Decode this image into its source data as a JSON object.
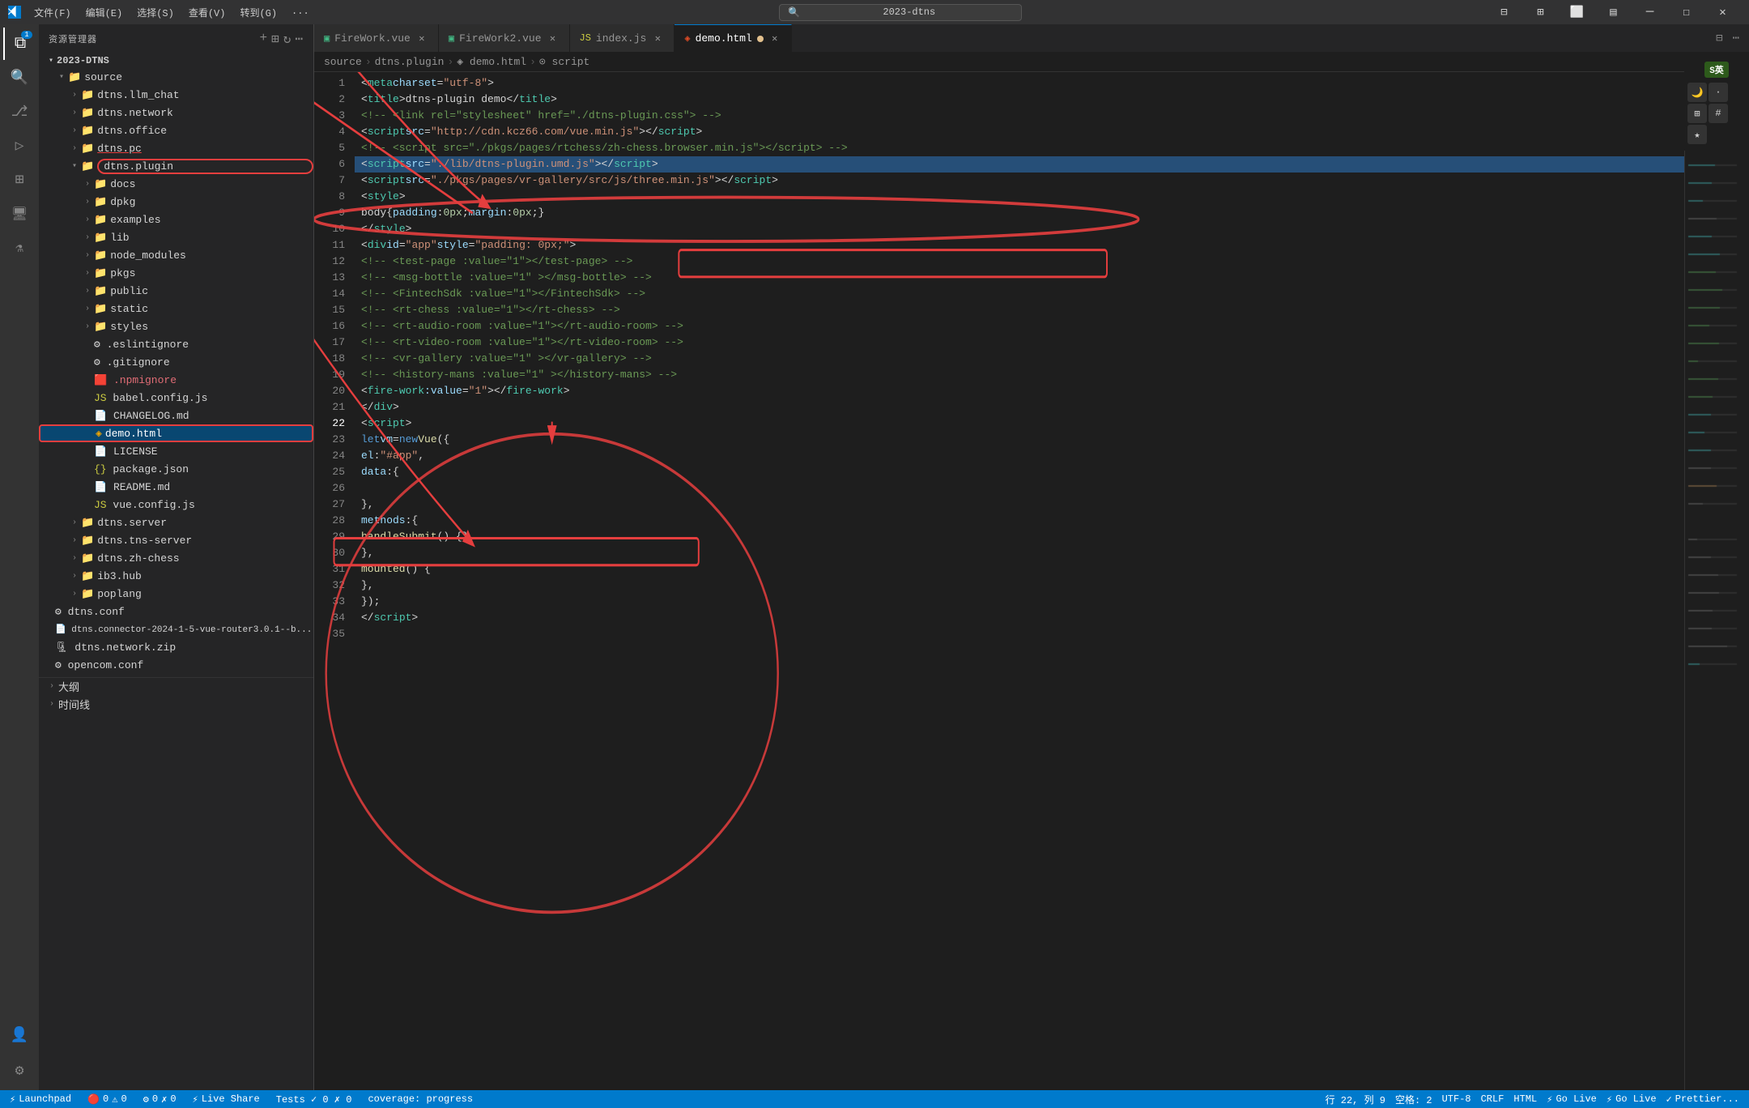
{
  "titleBar": {
    "icon": "VS",
    "menus": [
      "文件(F)",
      "编辑(E)",
      "选择(S)",
      "查看(V)",
      "转到(G)",
      "..."
    ],
    "searchPlaceholder": "2023-dtns",
    "controls": [
      "minimize",
      "maximize-restore",
      "close"
    ]
  },
  "activityBar": {
    "items": [
      {
        "name": "explorer",
        "icon": "⧉",
        "badge": "1",
        "active": true
      },
      {
        "name": "search",
        "icon": "🔍",
        "active": false
      },
      {
        "name": "source-control",
        "icon": "⎇",
        "active": false
      },
      {
        "name": "run-debug",
        "icon": "▷",
        "active": false
      },
      {
        "name": "extensions",
        "icon": "⊞",
        "active": false
      },
      {
        "name": "remote-explorer",
        "icon": "🖥",
        "active": false
      },
      {
        "name": "testing",
        "icon": "⚗",
        "active": false
      }
    ],
    "bottomItems": [
      {
        "name": "accounts",
        "icon": "👤"
      },
      {
        "name": "settings",
        "icon": "⚙"
      }
    ]
  },
  "sidebar": {
    "title": "资源管理器",
    "rootFolder": "2023-DTNS",
    "tree": [
      {
        "id": "source",
        "label": "source",
        "type": "folder",
        "indent": 0,
        "expanded": true
      },
      {
        "id": "dtns_llm_chat",
        "label": "dtns.llm_chat",
        "type": "folder",
        "indent": 1,
        "expanded": false
      },
      {
        "id": "dtns_network",
        "label": "dtns.network",
        "type": "folder",
        "indent": 1,
        "expanded": false
      },
      {
        "id": "dtns_office",
        "label": "dtns.office",
        "type": "folder",
        "indent": 1,
        "expanded": false
      },
      {
        "id": "dtns_pc",
        "label": "dtns.pc",
        "type": "folder",
        "indent": 1,
        "expanded": false,
        "highlighted": true
      },
      {
        "id": "dtns_plugin",
        "label": "dtns.plugin",
        "type": "folder",
        "indent": 1,
        "expanded": true,
        "circled": true
      },
      {
        "id": "docs",
        "label": "docs",
        "type": "folder",
        "indent": 2,
        "expanded": false
      },
      {
        "id": "dpkg",
        "label": "dpkg",
        "type": "folder",
        "indent": 2,
        "expanded": false
      },
      {
        "id": "examples",
        "label": "examples",
        "type": "folder",
        "indent": 2,
        "expanded": false
      },
      {
        "id": "lib",
        "label": "lib",
        "type": "folder",
        "indent": 2,
        "expanded": false
      },
      {
        "id": "node_modules",
        "label": "node_modules",
        "type": "folder",
        "indent": 2,
        "expanded": false
      },
      {
        "id": "pkgs",
        "label": "pkgs",
        "type": "folder",
        "indent": 2,
        "expanded": false
      },
      {
        "id": "public",
        "label": "public",
        "type": "folder",
        "indent": 2,
        "expanded": false
      },
      {
        "id": "static",
        "label": "static",
        "type": "folder",
        "indent": 2,
        "expanded": false
      },
      {
        "id": "styles",
        "label": "styles",
        "type": "folder",
        "indent": 2,
        "expanded": false
      },
      {
        "id": "eslintignore",
        "label": ".eslintignore",
        "type": "file",
        "indent": 2,
        "icon": "⚙"
      },
      {
        "id": "gitignore",
        "label": ".gitignore",
        "type": "file",
        "indent": 2,
        "icon": "⚙"
      },
      {
        "id": "npmignore",
        "label": ".npmignore",
        "type": "file",
        "indent": 2,
        "icon": "🟥"
      },
      {
        "id": "babel_config",
        "label": "babel.config.js",
        "type": "file",
        "indent": 2,
        "icon": "JS"
      },
      {
        "id": "changelog",
        "label": "CHANGELOG.md",
        "type": "file",
        "indent": 2,
        "icon": "📄"
      },
      {
        "id": "demo_html",
        "label": "demo.html",
        "type": "file",
        "indent": 2,
        "icon": "🔶",
        "active": true,
        "circled": true
      },
      {
        "id": "license",
        "label": "LICENSE",
        "type": "file",
        "indent": 2,
        "icon": "📄"
      },
      {
        "id": "package_json",
        "label": "package.json",
        "type": "file",
        "indent": 2,
        "icon": "{}"
      },
      {
        "id": "readme",
        "label": "README.md",
        "type": "file",
        "indent": 2,
        "icon": "📄"
      },
      {
        "id": "vue_config",
        "label": "vue.config.js",
        "type": "file",
        "indent": 2,
        "icon": "JS"
      },
      {
        "id": "dtns_server",
        "label": "dtns.server",
        "type": "folder",
        "indent": 1,
        "expanded": false
      },
      {
        "id": "dtns_tns_server",
        "label": "dtns.tns-server",
        "type": "folder",
        "indent": 1,
        "expanded": false
      },
      {
        "id": "dtns_zh_chess",
        "label": "dtns.zh-chess",
        "type": "folder",
        "indent": 1,
        "expanded": false
      },
      {
        "id": "ib3_hub",
        "label": "ib3.hub",
        "type": "folder",
        "indent": 1,
        "expanded": false
      },
      {
        "id": "poplang",
        "label": "poplang",
        "type": "folder",
        "indent": 1,
        "expanded": false
      },
      {
        "id": "dtns_conf",
        "label": "dtns.conf",
        "type": "file",
        "indent": 0,
        "icon": "⚙"
      },
      {
        "id": "dtns_connector",
        "label": "dtns.connector-2024-1-5-vue-router3.0.1--b...",
        "type": "file",
        "indent": 0,
        "icon": "📄"
      },
      {
        "id": "dtns_network_zip",
        "label": "dtns.network.zip",
        "type": "file",
        "indent": 0,
        "icon": "🗜"
      },
      {
        "id": "opencom_conf",
        "label": "opencom.conf",
        "type": "file",
        "indent": 0,
        "icon": "⚙"
      }
    ]
  },
  "tabs": [
    {
      "id": "firework_vue",
      "label": "FireWork.vue",
      "icon": "vue",
      "color": "#42b883",
      "modified": false,
      "active": false
    },
    {
      "id": "firework2_vue",
      "label": "FireWork2.vue",
      "icon": "vue",
      "color": "#42b883",
      "modified": false,
      "active": false
    },
    {
      "id": "index_js",
      "label": "index.js",
      "icon": "js",
      "color": "#cbcb41",
      "modified": false,
      "active": false
    },
    {
      "id": "demo_html",
      "label": "demo.html",
      "icon": "html",
      "color": "#e44d26",
      "modified": true,
      "active": true
    }
  ],
  "breadcrumb": {
    "items": [
      "source",
      "dtns.plugin",
      "demo.html",
      "script"
    ]
  },
  "codeLines": [
    {
      "num": 1,
      "html": "<span class='token-punct'>&lt;</span><span class='token-tag'>meta</span> <span class='token-attr'>charset</span><span class='token-punct'>=</span><span class='token-string'>\"utf-8\"</span><span class='token-punct'>&gt;</span>"
    },
    {
      "num": 2,
      "html": "<span class='token-punct'>&lt;</span><span class='token-tag'>title</span><span class='token-punct'>&gt;</span><span class='token-text'>dtns-plugin demo</span><span class='token-punct'>&lt;/</span><span class='token-tag'>title</span><span class='token-punct'>&gt;</span>"
    },
    {
      "num": 3,
      "html": "<span class='token-comment'>&lt;!-- &lt;link rel=\"stylesheet\" href=\"./dtns-plugin.css\"&gt; --&gt;</span>"
    },
    {
      "num": 4,
      "html": "<span class='token-punct'>&lt;</span><span class='token-tag'>script</span> <span class='token-attr'>src</span><span class='token-punct'>=</span><span class='token-string'>\"http://cdn.kcz66.com/vue.min.js\"</span><span class='token-punct'>&gt;&lt;/</span><span class='token-tag'>script</span><span class='token-punct'>&gt;</span>"
    },
    {
      "num": 5,
      "html": "<span class='token-comment'>&lt;!-- &lt;script src=\"./pkgs/pages/rtchess/zh-chess.browser.min.js\"&gt;&lt;/script&gt; --&gt;</span>"
    },
    {
      "num": 6,
      "html": "<span class='token-punct'>&lt;</span><span class='token-tag'>script</span> <span class='token-attr'>src</span><span class='token-punct'>=</span><span class='token-string'>\"./lib/dtns-plugin.umd.js\"</span><span class='token-punct'>&gt;&lt;/</span><span class='token-tag'>script</span><span class='token-punct'>&gt;</span>",
      "highlighted": true
    },
    {
      "num": 7,
      "html": "<span class='token-punct'>&lt;</span><span class='token-tag'>script</span> <span class='token-attr'>src</span><span class='token-punct'>=</span><span class='token-string'>\"./pkgs/pages/vr-gallery/src/js/three.min.js\"</span><span class='token-punct'>&gt;&lt;/</span><span class='token-tag'>script</span><span class='token-punct'>&gt;</span>"
    },
    {
      "num": 8,
      "html": "<span class='token-punct'>&lt;</span><span class='token-tag'>style</span><span class='token-punct'>&gt;</span>"
    },
    {
      "num": 9,
      "html": "  <span class='token-text'>body</span><span class='token-punct'>{</span><span class='token-property'>padding</span><span class='token-punct'>:</span> <span class='token-number'>0px</span><span class='token-punct'>;</span><span class='token-property'>margin</span><span class='token-punct'>:</span> <span class='token-number'>0px</span><span class='token-punct'>;}</span>"
    },
    {
      "num": 10,
      "html": "<span class='token-punct'>&lt;/</span><span class='token-tag'>style</span><span class='token-punct'>&gt;</span>"
    },
    {
      "num": 11,
      "html": "<span class='token-punct'>&lt;</span><span class='token-tag'>div</span> <span class='token-attr'>id</span><span class='token-punct'>=</span><span class='token-string'>\"app\"</span> <span class='token-attr'>style</span><span class='token-punct'>=</span><span class='token-string'>\"padding: 0px;\"</span><span class='token-punct'>&gt;</span>"
    },
    {
      "num": 12,
      "html": "  <span class='token-comment'>&lt;!-- &lt;test-page :value=\"1\"&gt;&lt;/test-page&gt; --&gt;</span>"
    },
    {
      "num": 13,
      "html": "  <span class='token-comment'>&lt;!-- &lt;msg-bottle :value=\"1\" &gt;&lt;/msg-bottle&gt; --&gt;</span>"
    },
    {
      "num": 14,
      "html": "  <span class='token-comment'>&lt;!-- &lt;FintechSdk :value=\"1\"&gt;&lt;/FintechSdk&gt; --&gt;</span>"
    },
    {
      "num": 15,
      "html": "  <span class='token-comment'>&lt;!-- &lt;rt-chess :value=\"1\"&gt;&lt;/rt-chess&gt; --&gt;</span>"
    },
    {
      "num": 16,
      "html": "  <span class='token-comment'>&lt;!-- &lt;rt-audio-room :value=\"1\"&gt;&lt;/rt-audio-room&gt; --&gt;</span>"
    },
    {
      "num": 17,
      "html": "  <span class='token-comment'>&lt;!-- &lt;rt-video-room :value=\"1\"&gt;&lt;/rt-video-room&gt; --&gt;</span>"
    },
    {
      "num": 18,
      "html": "  <span class='token-comment'>&lt;!-- &lt;vr-gallery :value=\"1\" &gt;&lt;/vr-gallery&gt; --&gt;</span>"
    },
    {
      "num": 19,
      "html": "  <span class='token-comment'>&lt;!-- &lt;history-mans :value=\"1\" &gt;&lt;/history-mans&gt; --&gt;</span>"
    },
    {
      "num": 20,
      "html": "  <span class='token-punct'>&lt;</span><span class='token-tag'>fire-work</span> <span class='token-attr'>:value</span><span class='token-punct'>=</span><span class='token-string'>\"1\"</span> <span class='token-punct'>&gt;&lt;/</span><span class='token-tag'>fire-work</span><span class='token-punct'>&gt;</span>"
    },
    {
      "num": 21,
      "html": "<span class='token-punct'>&lt;/</span><span class='token-tag'>div</span><span class='token-punct'>&gt;</span>"
    },
    {
      "num": 22,
      "html": "<span class='token-punct'>&lt;</span><span class='token-tag'>script</span><span class='token-punct'>&gt;</span>"
    },
    {
      "num": 23,
      "html": "<span class='token-keyword'>let</span> <span class='token-var'>vm</span> <span class='token-punct'>=</span> <span class='token-keyword'>new</span> <span class='token-func'>Vue</span><span class='token-punct'>({</span>"
    },
    {
      "num": 24,
      "html": "    <span class='token-property'>el</span><span class='token-punct'>:</span> <span class='token-string'>\"#app\"</span><span class='token-punct'>,</span>"
    },
    {
      "num": 25,
      "html": "    <span class='token-property'>data</span><span class='token-punct'>:</span> <span class='token-punct'>{</span>"
    },
    {
      "num": 26,
      "html": ""
    },
    {
      "num": 27,
      "html": "    <span class='token-punct'>},</span>"
    },
    {
      "num": 28,
      "html": "    <span class='token-property'>methods</span><span class='token-punct'>:</span> <span class='token-punct'>{</span>"
    },
    {
      "num": 29,
      "html": "      <span class='token-func'>handleSubmit</span><span class='token-punct'>() {},</span>"
    },
    {
      "num": 30,
      "html": "    <span class='token-punct'>},</span>"
    },
    {
      "num": 31,
      "html": "    <span class='token-func'>mounted</span><span class='token-punct'>() {</span>"
    },
    {
      "num": 32,
      "html": "    <span class='token-punct'>},</span>"
    },
    {
      "num": 33,
      "html": "  <span class='token-punct'>});</span>"
    },
    {
      "num": 34,
      "html": "<span class='token-punct'>&lt;/</span><span class='token-tag'>script</span><span class='token-punct'>&gt;</span>"
    },
    {
      "num": 35,
      "html": ""
    }
  ],
  "statusBar": {
    "leftItems": [
      {
        "icon": "⚡",
        "label": "Launchpad"
      },
      {
        "icon": "🔴",
        "label": "0"
      },
      {
        "icon": "⚠",
        "label": "0"
      },
      {
        "icon": "⚙",
        "label": "0"
      },
      {
        "icon": "✗",
        "label": "0"
      },
      {
        "label": "Live Share"
      },
      {
        "label": "Tests  ✓ 0  ✗ 0"
      },
      {
        "label": "coverage: progress"
      }
    ],
    "rightItems": [
      {
        "label": "行 22, 列 9"
      },
      {
        "label": "空格: 2"
      },
      {
        "label": "UTF-8"
      },
      {
        "label": "CRLF"
      },
      {
        "label": "HTML"
      },
      {
        "label": "Go Live"
      },
      {
        "label": "Go Live"
      },
      {
        "label": "✓ Prettier..."
      }
    ],
    "liveShareLabel": "Live Share"
  }
}
